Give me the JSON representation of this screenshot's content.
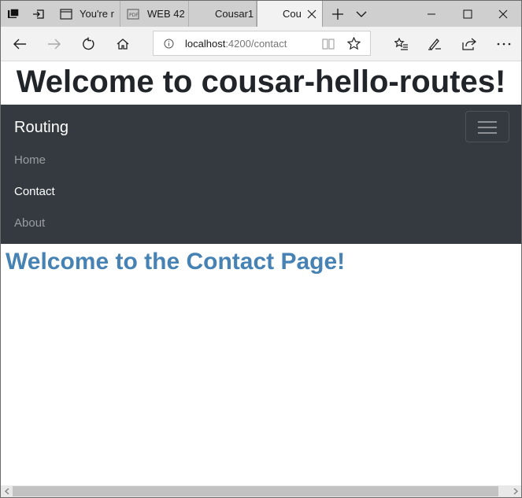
{
  "browser": {
    "tabs": [
      {
        "label": "You're r",
        "icon": "page-icon"
      },
      {
        "label": "WEB 42",
        "icon": "pdf-icon"
      },
      {
        "label": "Cousar1",
        "icon": ""
      },
      {
        "label": "Cou",
        "icon": "",
        "active": true
      }
    ],
    "url_host": "localhost",
    "url_path": ":4200/contact"
  },
  "page": {
    "heading": "Welcome to cousar-hello-routes!",
    "navbar": {
      "brand": "Routing",
      "links": [
        {
          "label": "Home",
          "active": false
        },
        {
          "label": "Contact",
          "active": true
        },
        {
          "label": "About",
          "active": false
        }
      ]
    },
    "content_heading": "Welcome to the Contact Page!"
  },
  "colors": {
    "navbar_bg": "#343a40",
    "content_heading": "#4682b4",
    "tabstrip_bg": "#cfcfcf",
    "toolbar_bg": "#f2f2f2"
  }
}
